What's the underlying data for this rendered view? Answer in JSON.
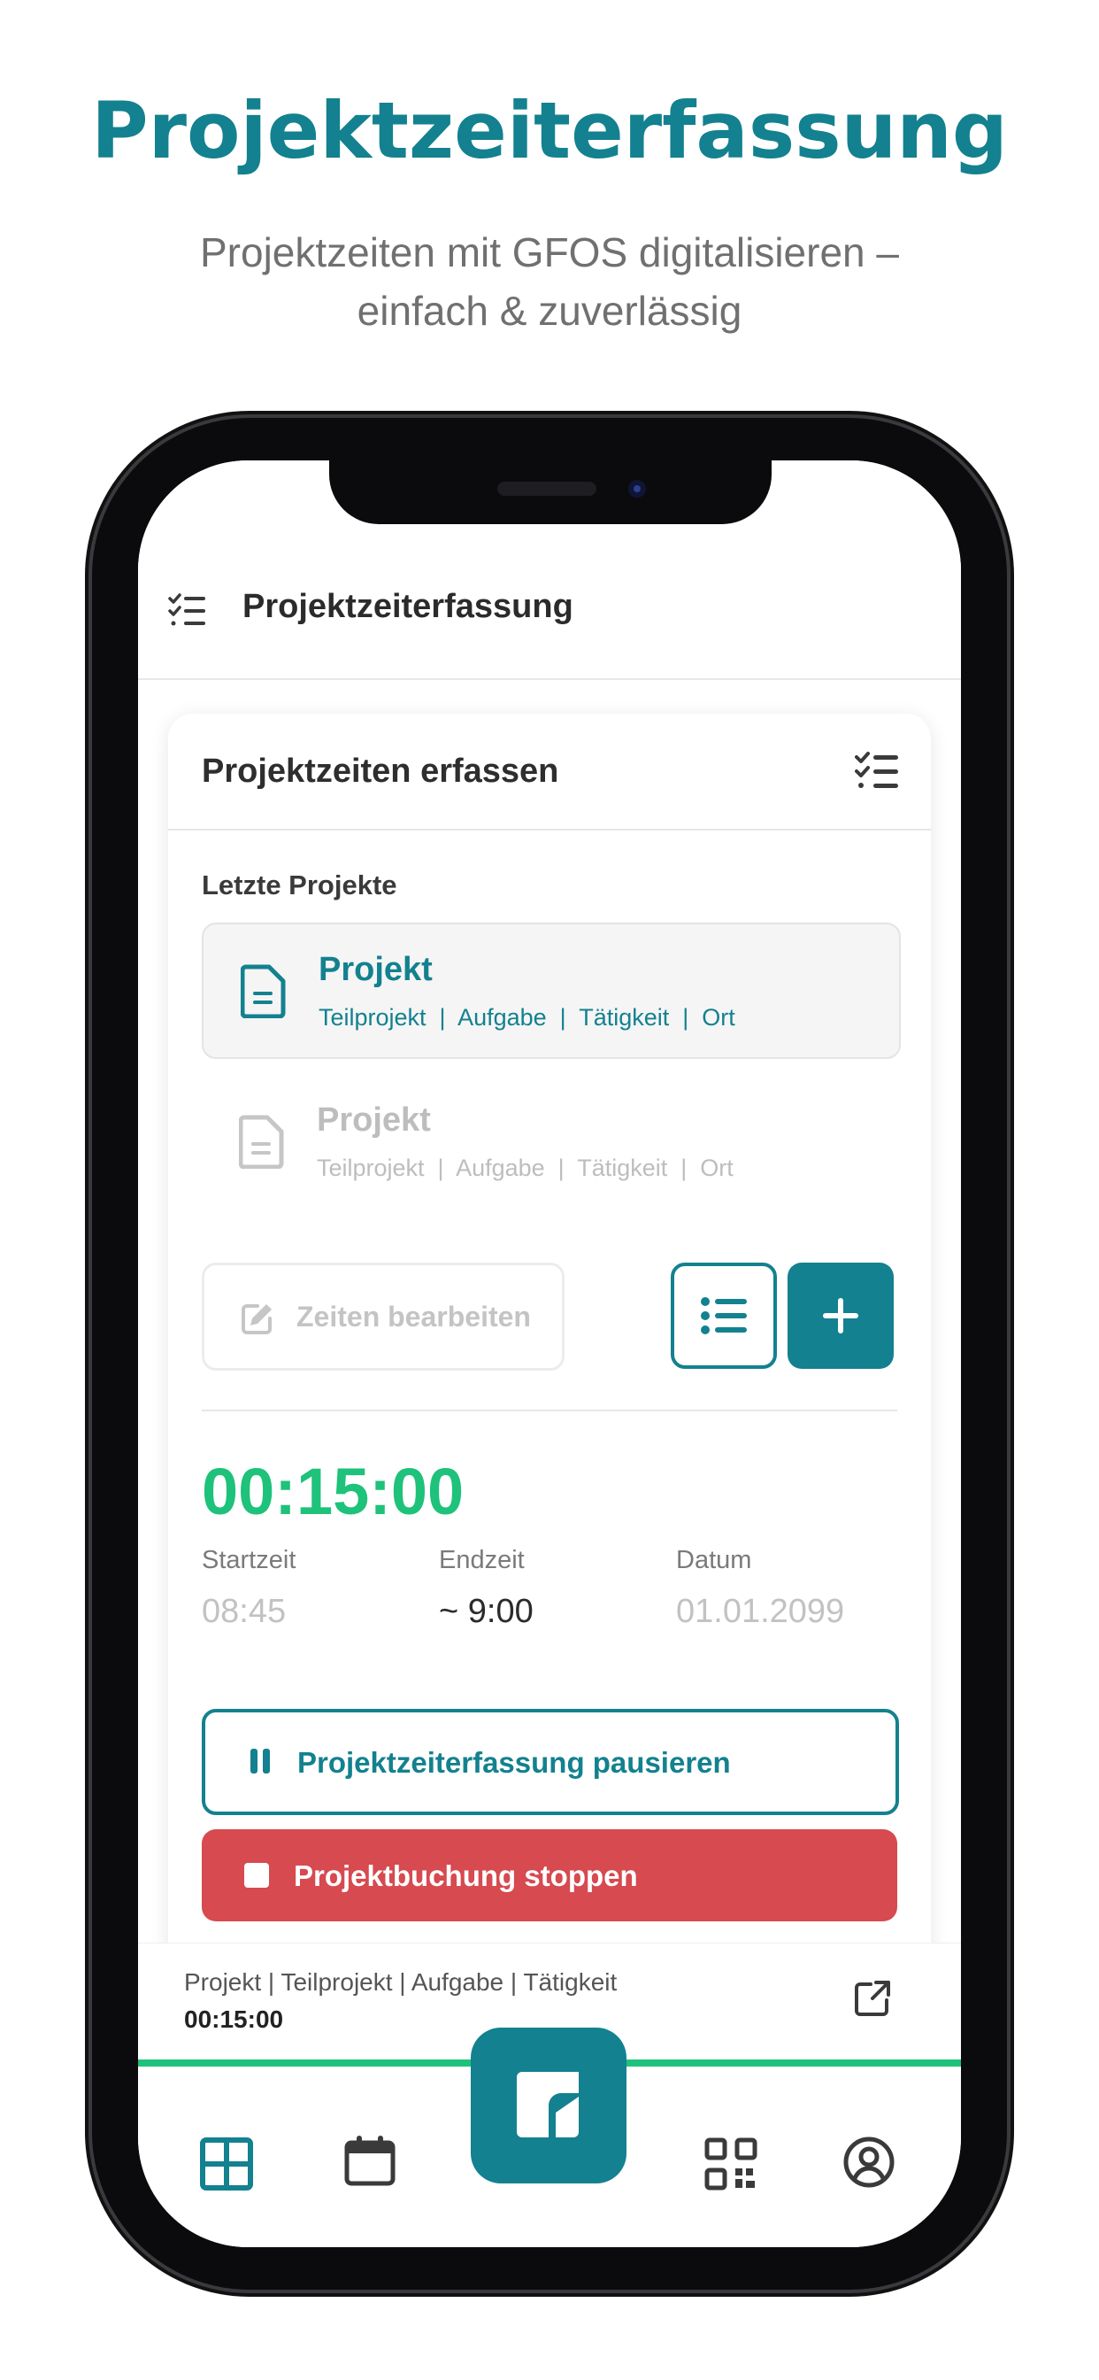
{
  "headline": "Projektzeiterfassung",
  "subline": "Projektzeiten mit GFOS digitalisieren –",
  "subline2": "einfach & zuverlässig",
  "colors": {
    "accent": "#13818f",
    "timer": "#1ec27a",
    "stop": "#d64a50"
  },
  "appbar": {
    "title": "Projektzeiterfassung",
    "menu_icon": "checklist-icon"
  },
  "card": {
    "title": "Projektzeiten erfassen",
    "section_label": "Letzte Projekte",
    "projects": [
      {
        "name": "Projekt",
        "meta": "Teilprojekt  |  Aufgabe  |  Tätigkeit  |  Ort"
      },
      {
        "name": "Projekt",
        "meta": "Teilprojekt  |  Aufgabe  |  Tätigkeit  |  Ort"
      }
    ],
    "edit_label": "Zeiten bearbeiten",
    "timer": "00:15:00",
    "stats": {
      "start_label": "Startzeit",
      "start_value": "08:45",
      "end_label": "Endzeit",
      "end_value": "~ 9:00",
      "date_label": "Datum",
      "date_value": "01.01.2099"
    },
    "pause_label": "Projektzeiterfassung pausieren",
    "stop_label": "Projektbuchung stoppen"
  },
  "mini_player": {
    "path": "Projekt | Teilprojekt | Aufgabe | Tätigkeit",
    "time": "00:15:00"
  },
  "nav": [
    "dashboard-icon",
    "calendar-icon",
    "home-logo-icon",
    "qr-code-icon",
    "profile-icon"
  ]
}
